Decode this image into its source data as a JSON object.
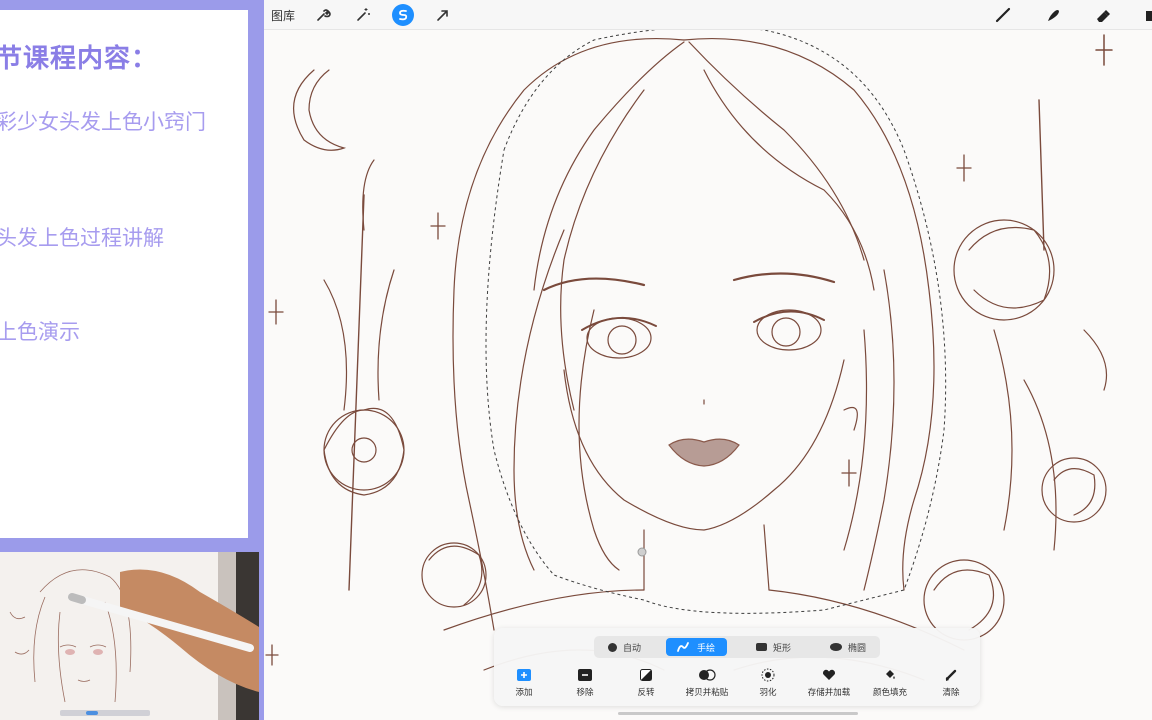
{
  "lesson": {
    "title": "节课程内容：",
    "items": [
      "彩少女头发上色小窍门",
      "头发上色过程讲解",
      "上色演示"
    ]
  },
  "toolbar": {
    "gallery": "图库",
    "left_icons": [
      "wrench-icon",
      "magic-wand-icon",
      "selection-icon",
      "transform-arrow-icon"
    ],
    "right_icons": [
      "brush-icon",
      "smudge-icon",
      "eraser-icon",
      "layers-icon"
    ],
    "active_tool": "selection-icon"
  },
  "selection_panel": {
    "modes": [
      "自动",
      "手绘",
      "矩形",
      "椭圆"
    ],
    "active_mode": "手绘",
    "actions": [
      "添加",
      "移除",
      "反转",
      "拷贝并粘贴",
      "羽化",
      "存储并加载",
      "颜色填充",
      "清除"
    ]
  },
  "colors": {
    "frame": "#9b9bea",
    "accent": "#1e8fff",
    "line_art": "#7a4a3c",
    "lesson_text": "#a79cef"
  }
}
